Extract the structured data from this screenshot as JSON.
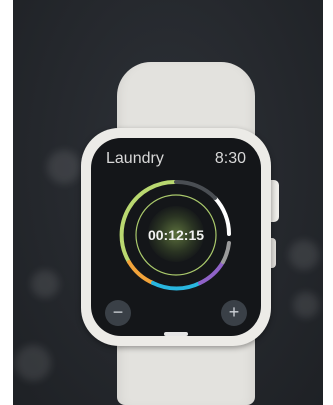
{
  "app": {
    "title": "Laundry",
    "time": "8:30",
    "timer": "00:12:15"
  },
  "controls": {
    "minus_glyph": "−",
    "plus_glyph": "+"
  },
  "ring_colors": [
    "#b9d870",
    "#f2a33a",
    "#29b6df",
    "#8f62c8",
    "#9b9b9b",
    "#ffffff",
    "#4a4e53"
  ],
  "icons": [
    "minus-icon",
    "plus-icon"
  ]
}
